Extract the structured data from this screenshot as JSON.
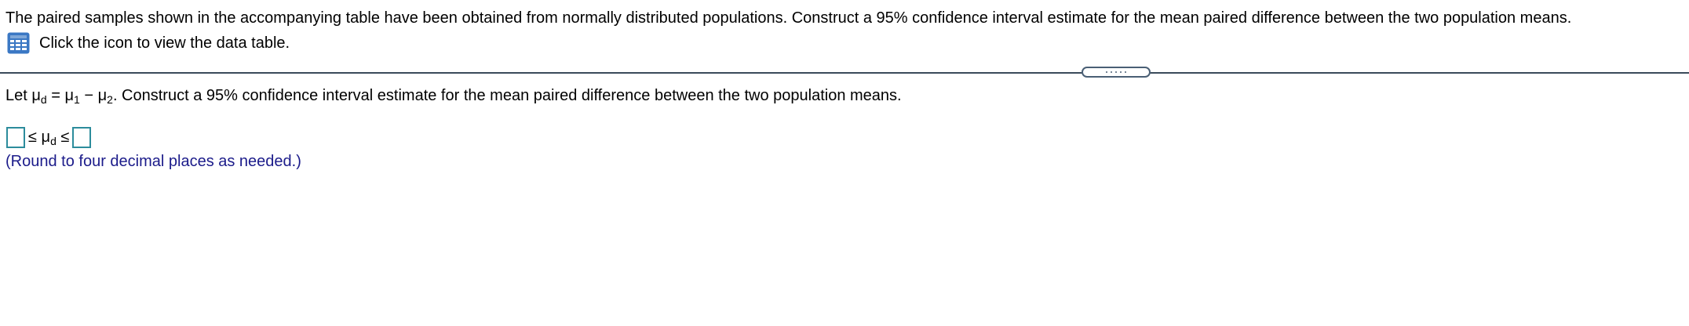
{
  "question": {
    "text": "The paired samples shown in the accompanying table have been obtained from normally distributed populations. Construct a 95% confidence interval estimate for the mean paired difference between the two population means."
  },
  "data_link": {
    "icon": "table-grid-icon",
    "label": "Click the icon to view the data table."
  },
  "let_line": {
    "prefix": "Let ",
    "mu": "μ",
    "sub_d": "d",
    "equals": " = ",
    "sub_1": "1",
    "minus": " − ",
    "sub_2": "2",
    "rest": ". Construct a 95% confidence interval estimate for the mean paired difference between the two population means."
  },
  "interval": {
    "le_left": "≤",
    "mu": "μ",
    "sub_d": "d",
    "le_right": "≤",
    "lower_value": "",
    "upper_value": ""
  },
  "hint": {
    "text": "(Round to four decimal places as needed.)"
  },
  "colors": {
    "icon_blue": "#3b78c4",
    "answer_box_border": "#2c8c9c",
    "hint_text": "#1b1b8a",
    "divider": "#3a4a5a"
  }
}
